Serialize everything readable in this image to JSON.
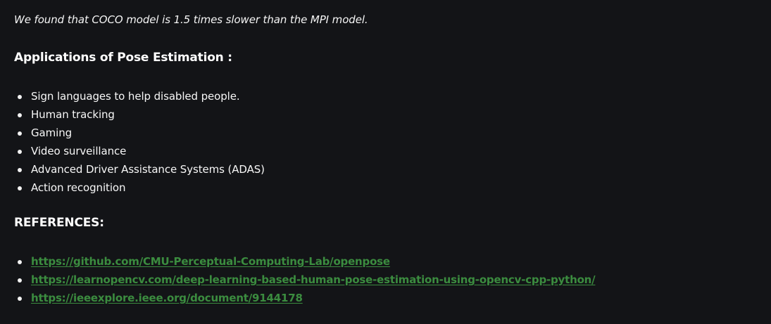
{
  "intro": {
    "text": "We found that COCO model is 1.5 times slower than the MPI model."
  },
  "applications": {
    "heading": "Applications of Pose Estimation :",
    "items": [
      "Sign languages to help disabled people.",
      "Human tracking",
      "Gaming",
      "Video surveillance",
      "Advanced Driver Assistance Systems (ADAS)",
      "Action recognition"
    ]
  },
  "references": {
    "heading": "REFERENCES:",
    "links": [
      "https://github.com/CMU-Perceptual-Computing-Lab/openpose",
      "https://learnopencv.com/deep-learning-based-human-pose-estimation-using-opencv-cpp-python/",
      "https://ieeexplore.ieee.org/document/9144178"
    ]
  },
  "colors": {
    "background": "#131417",
    "text": "#f2f2f2",
    "link": "#3b8c3f"
  }
}
